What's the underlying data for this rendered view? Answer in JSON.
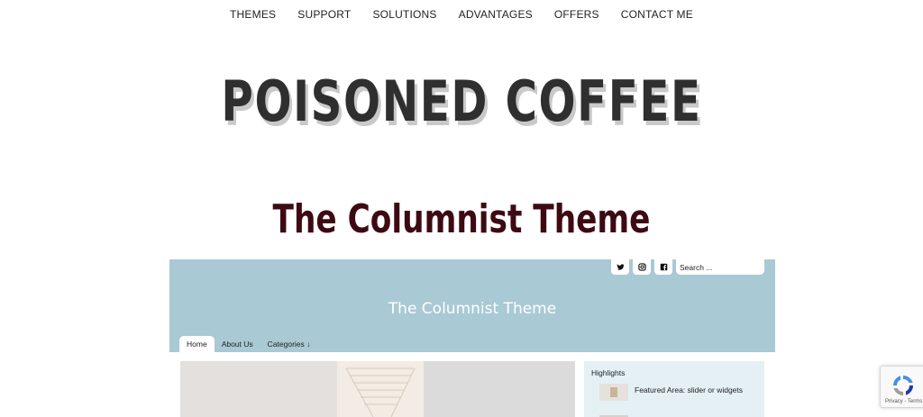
{
  "nav": {
    "items": [
      "THEMES",
      "SUPPORT",
      "SOLUTIONS",
      "ADVANTAGES",
      "OFFERS",
      "CONTACT ME"
    ]
  },
  "site_title": "POISONED COFFEE",
  "heading": "The Columnist Theme",
  "preview": {
    "search_placeholder": "Search ...",
    "title": "The Columnist Theme",
    "menu": [
      "Home",
      "About Us",
      "Categories ↓"
    ],
    "sidebar": {
      "title": "Highlights",
      "item": "Featured Area: slider or widgets"
    },
    "icons": [
      "twitter-icon",
      "instagram-icon",
      "facebook-icon"
    ]
  },
  "recaptcha": {
    "text": "Privacy - Terms"
  },
  "colors": {
    "heading": "#3d0a14",
    "header_bg": "#a9c9d4",
    "sidebar_bg": "#e4f0f4"
  }
}
